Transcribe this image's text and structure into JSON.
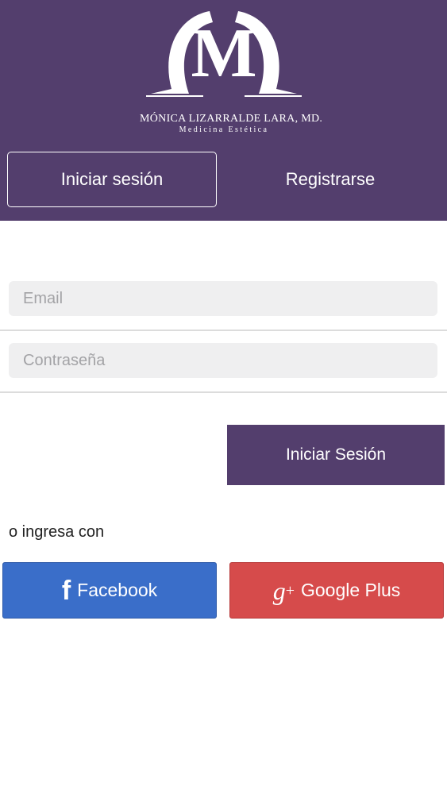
{
  "brand": {
    "logo_letter": "M",
    "name": "MÓNICA LIZARRALDE LARA, MD.",
    "subtitle": "Medicina Estética"
  },
  "tabs": {
    "login_label": "Iniciar sesión",
    "register_label": "Registrarse"
  },
  "form": {
    "email_placeholder": "Email",
    "password_placeholder": "Contraseña",
    "submit_label": "Iniciar Sesión"
  },
  "social": {
    "or_text": "o ingresa con",
    "facebook_label": "Facebook",
    "facebook_icon": "f",
    "google_label": "Google Plus",
    "google_icon": "g",
    "google_icon_sup": "+"
  },
  "colors": {
    "brand_purple": "#533e6d",
    "facebook_blue": "#3a6ec9",
    "google_red": "#d64b4b"
  }
}
